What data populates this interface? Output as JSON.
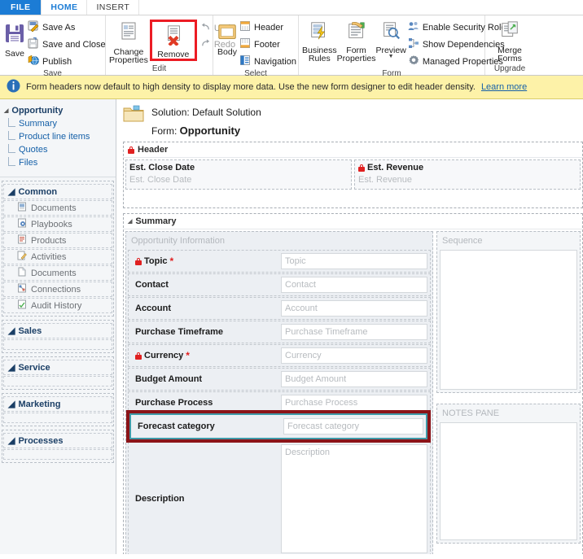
{
  "window": {
    "tabs": [
      {
        "label": "FILE",
        "kind": "file"
      },
      {
        "label": "HOME",
        "kind": "active"
      },
      {
        "label": "INSERT",
        "kind": "normal"
      }
    ]
  },
  "ribbon": {
    "groups": [
      {
        "name": "save",
        "label": "Save",
        "big": {
          "label": "Save",
          "icon": "floppy-disk-icon"
        },
        "small": [
          {
            "label": "Save As",
            "icon": "save-as-icon"
          },
          {
            "label": "Save and Close",
            "icon": "save-and-close-icon"
          },
          {
            "label": "Publish",
            "icon": "publish-icon"
          }
        ]
      },
      {
        "name": "edit",
        "label": "Edit",
        "big": [
          {
            "label": "Change Properties",
            "icon": "change-properties-icon"
          },
          {
            "label": "Remove",
            "icon": "remove-icon",
            "highlighted": true
          }
        ],
        "small": [
          {
            "label": "Undo",
            "icon": "undo-arrow-icon",
            "disabled": true
          },
          {
            "label": "Redo",
            "icon": "redo-arrow-icon",
            "disabled": true
          }
        ]
      },
      {
        "name": "select",
        "label": "Select",
        "big": {
          "label": "Body",
          "icon": "body-icon"
        },
        "small": [
          {
            "label": "Header",
            "icon": "header-icon"
          },
          {
            "label": "Footer",
            "icon": "footer-icon"
          },
          {
            "label": "Navigation",
            "icon": "navigation-icon"
          }
        ]
      },
      {
        "name": "form",
        "label": "Form",
        "big": [
          {
            "label": "Business Rules",
            "icon": "business-rules-icon"
          },
          {
            "label": "Form Properties",
            "icon": "form-properties-icon"
          },
          {
            "label": "Preview",
            "icon": "preview-icon",
            "dropdown": true
          }
        ],
        "small": [
          {
            "label": "Enable Security Roles",
            "icon": "security-roles-icon"
          },
          {
            "label": "Show Dependencies",
            "icon": "dependencies-icon"
          },
          {
            "label": "Managed Properties",
            "icon": "managed-properties-icon"
          }
        ]
      },
      {
        "name": "upgrade",
        "label": "Upgrade",
        "big": {
          "label": "Merge Forms",
          "icon": "merge-forms-icon"
        }
      }
    ]
  },
  "notification": {
    "icon": "info-icon",
    "text": "Form headers now default to high density to display more data. Use the new form designer to edit header density.",
    "link": "Learn more"
  },
  "sidebar": {
    "top_section": {
      "label": "Opportunity",
      "links": [
        "Summary",
        "Product line items",
        "Quotes",
        "Files"
      ]
    },
    "groups": [
      {
        "label": "Common",
        "items": [
          {
            "label": "Documents",
            "icon": "documents-icon"
          },
          {
            "label": "Playbooks",
            "icon": "playbooks-icon"
          },
          {
            "label": "Products",
            "icon": "products-icon"
          },
          {
            "label": "Activities",
            "icon": "activities-icon"
          },
          {
            "label": "Documents",
            "icon": "documents-icon"
          },
          {
            "label": "Connections",
            "icon": "connections-icon"
          },
          {
            "label": "Audit History",
            "icon": "audit-history-icon"
          }
        ]
      },
      {
        "label": "Sales",
        "items": []
      },
      {
        "label": "Service",
        "items": []
      },
      {
        "label": "Marketing",
        "items": []
      },
      {
        "label": "Processes",
        "items": []
      }
    ]
  },
  "canvas": {
    "solution_line": "Solution: Default Solution",
    "form_prefix": "Form: ",
    "form_name": "Opportunity",
    "folder_icon": "folder-icon",
    "header_section": {
      "title": "Header",
      "locked": true,
      "columns": [
        {
          "label": "Est. Close Date",
          "placeholder": "Est. Close Date",
          "locked": false
        },
        {
          "label": "Est. Revenue",
          "placeholder": "Est. Revenue",
          "locked": true
        }
      ]
    },
    "summary_section": {
      "title": "Summary",
      "subsection_title": "Opportunity Information",
      "fields": [
        {
          "label": "Topic",
          "placeholder": "Topic",
          "locked": true,
          "required": true
        },
        {
          "label": "Contact",
          "placeholder": "Contact",
          "locked": false,
          "required": false
        },
        {
          "label": "Account",
          "placeholder": "Account",
          "locked": false,
          "required": false
        },
        {
          "label": "Purchase Timeframe",
          "placeholder": "Purchase Timeframe",
          "locked": false,
          "required": false
        },
        {
          "label": "Currency",
          "placeholder": "Currency",
          "locked": true,
          "required": true
        },
        {
          "label": "Budget Amount",
          "placeholder": "Budget Amount",
          "locked": false,
          "required": false
        },
        {
          "label": "Purchase Process",
          "placeholder": "Purchase Process",
          "locked": false,
          "required": false
        },
        {
          "label": "Forecast category",
          "placeholder": "Forecast category",
          "locked": false,
          "required": false,
          "selected": true
        }
      ],
      "description_field": {
        "label": "Description",
        "placeholder": "Description"
      },
      "right_panes": [
        {
          "label": "Sequence"
        },
        {
          "label": "NOTES PANE"
        }
      ]
    }
  },
  "colors": {
    "file_tab_blue": "#1c7cd5",
    "notification_yellow": "#fdf2a8",
    "highlight_red": "#ec1c24",
    "selection_red": "#8b1418",
    "selection_teal": "#3f9aa8",
    "required_red": "#e02020"
  }
}
